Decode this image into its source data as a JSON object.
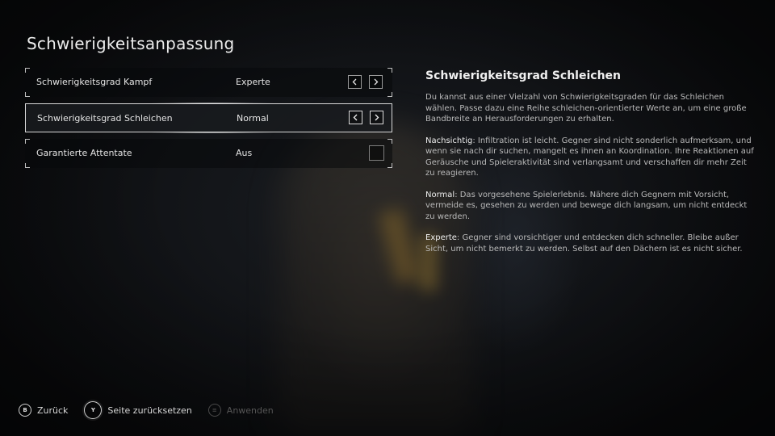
{
  "header": {
    "title": "Schwierigkeitsanpassung"
  },
  "settings": [
    {
      "label": "Schwierigkeitsgrad Kampf",
      "value": "Experte",
      "control": "arrows"
    },
    {
      "label": "Schwierigkeitsgrad Schleichen",
      "value": "Normal",
      "control": "arrows",
      "selected": true
    },
    {
      "label": "Garantierte Attentate",
      "value": "Aus",
      "control": "checkbox"
    }
  ],
  "description": {
    "title": "Schwierigkeitsgrad Schleichen",
    "intro": "Du kannst aus einer Vielzahl von Schwierigkeitsgraden für das Schleichen wählen. Passe dazu eine Reihe schleichen-orientierter Werte an, um eine große Bandbreite an Herausforderungen zu erhalten.",
    "levels": [
      {
        "term": "Nachsichtig",
        "text": ": Infiltration ist leicht. Gegner sind nicht sonderlich aufmerksam, und wenn sie nach dir suchen, mangelt es ihnen an Koordination. Ihre Reaktionen auf Geräusche und Spieleraktivität sind verlangsamt und verschaffen dir mehr Zeit zu reagieren."
      },
      {
        "term": "Normal",
        "text": ": Das vorgesehene Spielerlebnis. Nähere dich Gegnern mit Vorsicht, vermeide es, gesehen zu werden und bewege dich langsam, um nicht entdeckt zu werden."
      },
      {
        "term": "Experte",
        "text": ": Gegner sind vorsichtiger und entdecken dich schneller. Bleibe außer Sicht, um nicht bemerkt zu werden. Selbst auf den Dächern ist es nicht sicher."
      }
    ]
  },
  "footer": {
    "back": {
      "glyph": "B",
      "label": "Zurück"
    },
    "reset": {
      "glyph": "Y",
      "label": "Seite zurücksetzen"
    },
    "apply": {
      "glyph": "≡",
      "label": "Anwenden",
      "disabled": true
    }
  },
  "icons": {
    "arrow_left": "chevron-left-icon",
    "arrow_right": "chevron-right-icon"
  },
  "colors": {
    "text": "#e4e4e4",
    "muted": "#b9b9b9",
    "selected_border": "#d8d8d8",
    "background": "#0b0c0e"
  }
}
